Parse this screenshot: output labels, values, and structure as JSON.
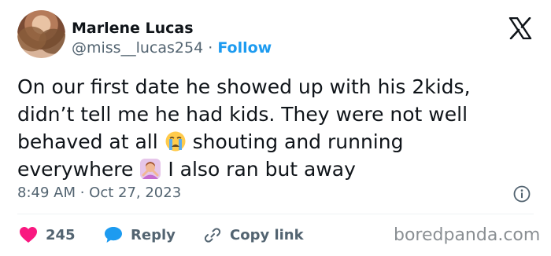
{
  "author": {
    "name": "Marlene Lucas",
    "handle": "@miss__lucas254",
    "separator": "·",
    "follow_label": "Follow"
  },
  "tweet": {
    "line1": "On our first date he showed up with his 2kids,",
    "line2": "didn’t tell me he had kids. They were not well",
    "line3_before_emoji": "behaved at all",
    "line3_after_emoji": "shouting and running",
    "line4_before_emoji": "everywhere",
    "line4_after_emoji": "I also ran but away",
    "timestamp": "8:49 AM · Oct 27, 2023"
  },
  "actions": {
    "like_count": "245",
    "reply_label": "Reply",
    "copy_link_label": "Copy link"
  },
  "watermark": "boredpanda.com",
  "icons": [
    "x-logo-icon",
    "crying-face-emoji-icon",
    "person-gesturing-no-emoji-icon",
    "info-icon",
    "heart-icon",
    "reply-bubble-icon",
    "link-icon"
  ],
  "colors": {
    "accent": "#1d9bf0",
    "like": "#f91880",
    "text": "#0f1419",
    "muted": "#536471"
  }
}
